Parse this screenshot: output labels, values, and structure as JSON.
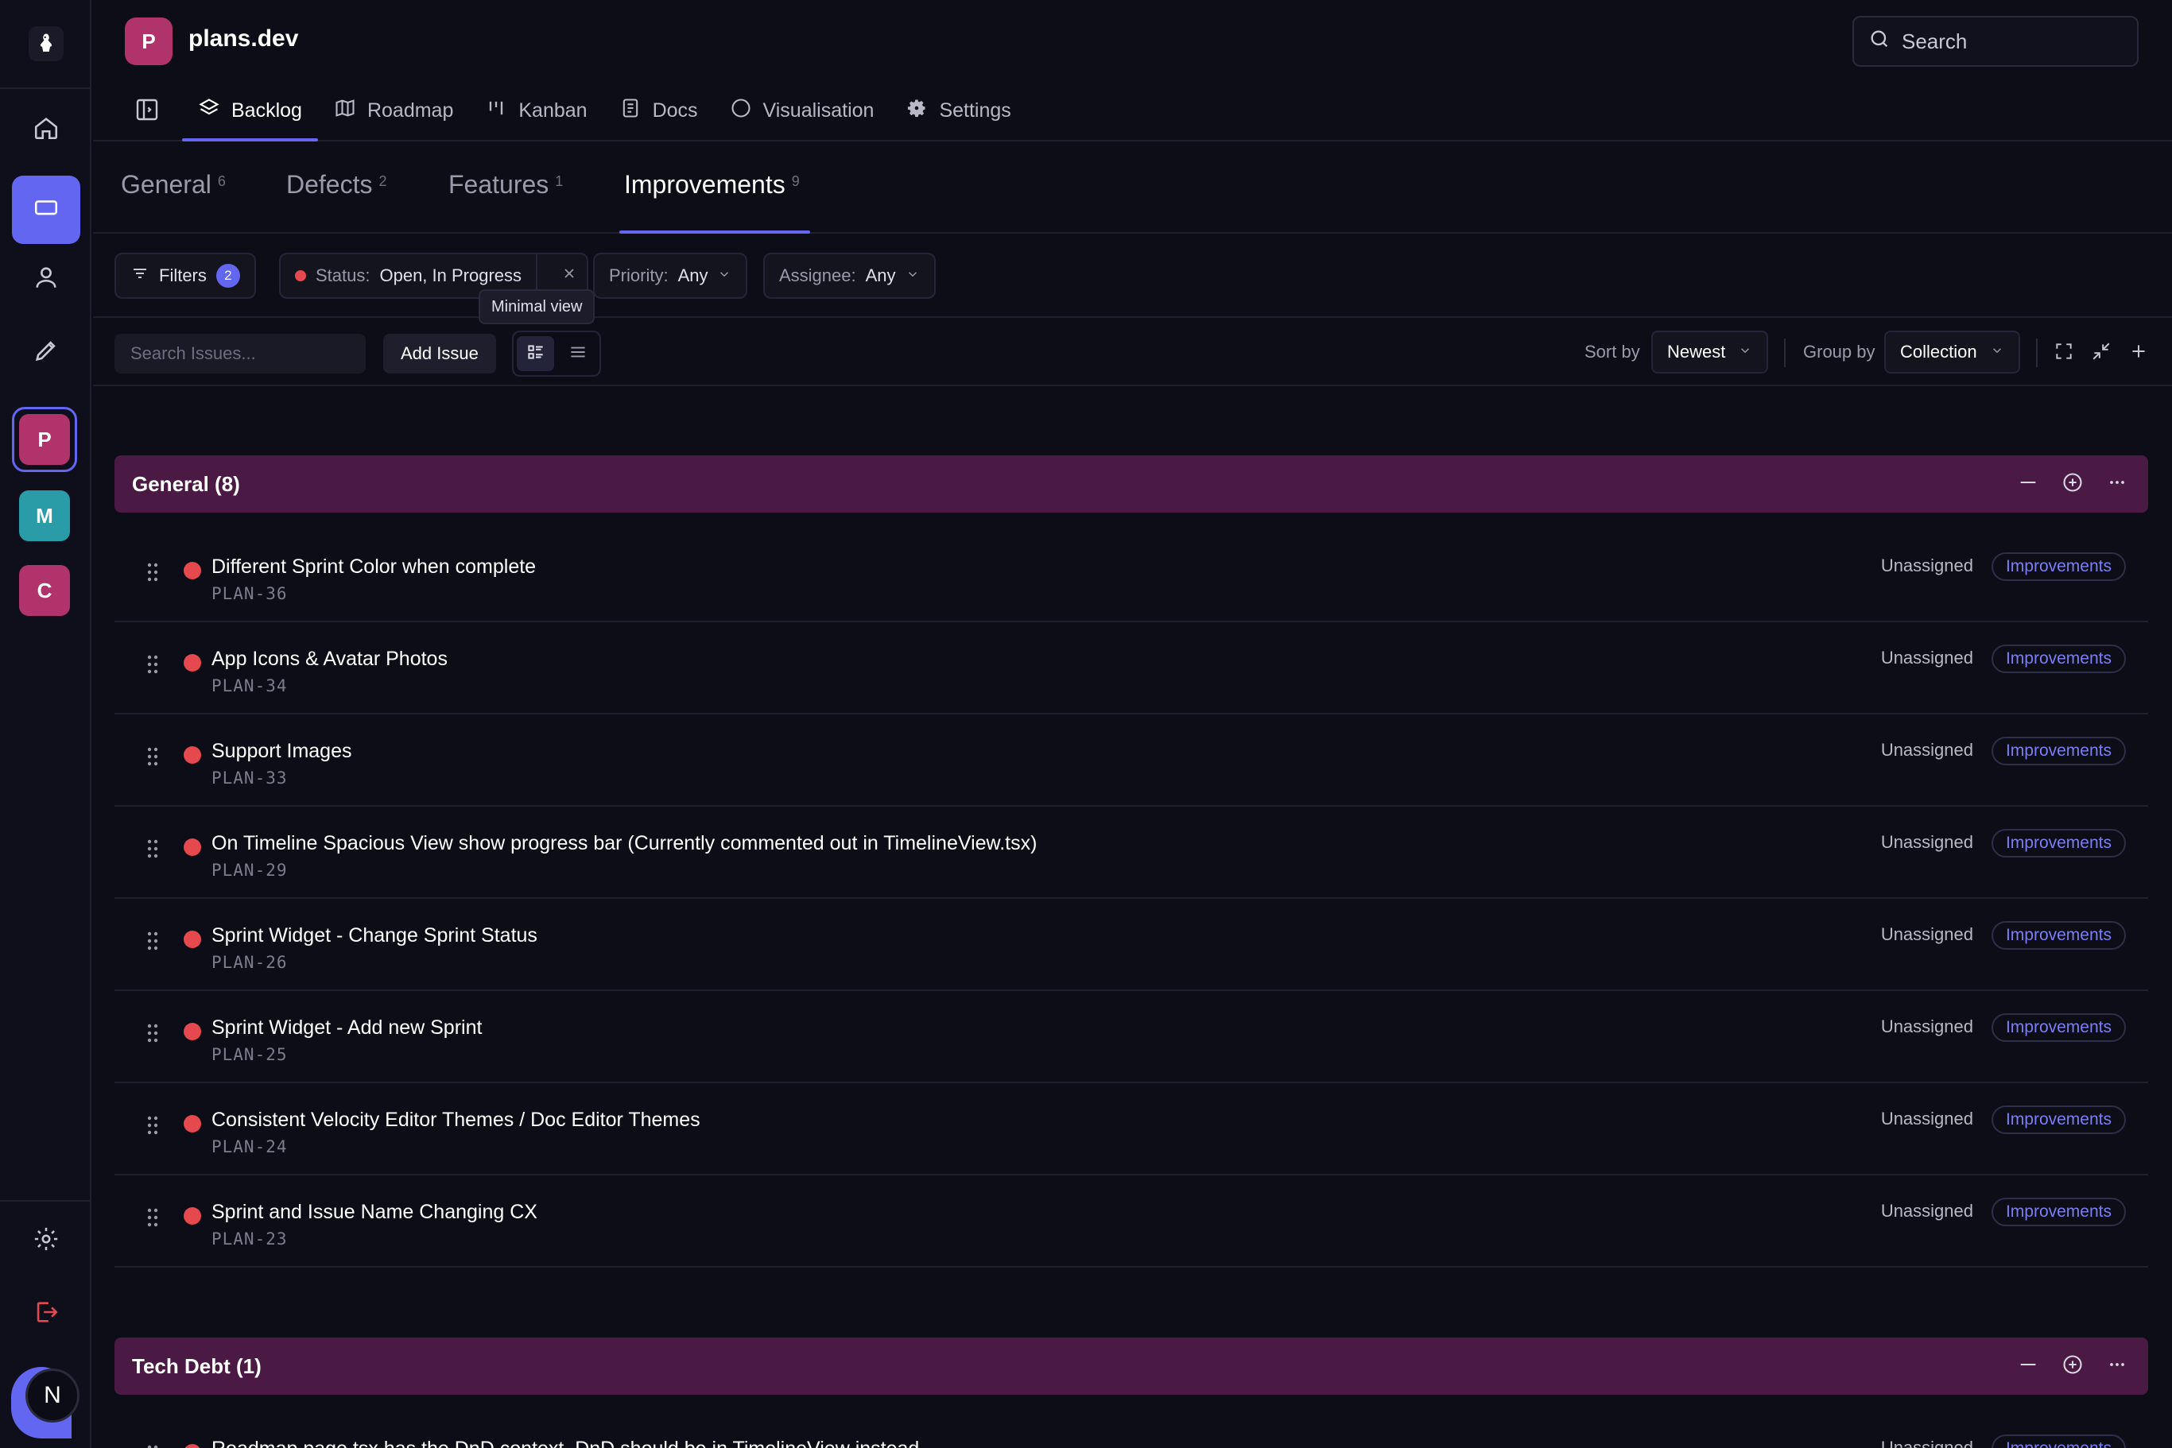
{
  "app": {
    "logo_icon": "mascot-icon",
    "project_initial": "P",
    "project_name": "plans.dev"
  },
  "sidebar": {
    "nav_icons": [
      "home-icon",
      "board-icon",
      "user-icon",
      "pencil-icon"
    ],
    "projects": [
      {
        "initial": "P",
        "color": "#b1336b",
        "active": true
      },
      {
        "initial": "M",
        "color": "#2a9ca8",
        "active": false
      },
      {
        "initial": "C",
        "color": "#b1336b",
        "active": false
      }
    ],
    "user_initial": "N",
    "accent": "#6366f1"
  },
  "search": {
    "placeholder": "Search"
  },
  "nav": {
    "tabs": [
      {
        "label": "Backlog",
        "icon": "layers-icon",
        "active": true
      },
      {
        "label": "Roadmap",
        "icon": "map-icon",
        "active": false
      },
      {
        "label": "Kanban",
        "icon": "kanban-icon",
        "active": false
      },
      {
        "label": "Docs",
        "icon": "doc-icon",
        "active": false
      },
      {
        "label": "Visualisation",
        "icon": "circle-icon",
        "active": false
      },
      {
        "label": "Settings",
        "icon": "gear-icon",
        "active": false
      }
    ]
  },
  "categories": [
    {
      "label": "General",
      "count": "6"
    },
    {
      "label": "Defects",
      "count": "2"
    },
    {
      "label": "Features",
      "count": "1"
    },
    {
      "label": "Improvements",
      "count": "9",
      "active": true
    }
  ],
  "filters": {
    "filters_label": "Filters",
    "filters_count": "2",
    "status_label": "Status:",
    "status_value": "Open, In Progress",
    "priority_label": "Priority:",
    "priority_value": "Any",
    "assignee_label": "Assignee:",
    "assignee_value": "Any",
    "tooltip": "Minimal view"
  },
  "toolbar": {
    "search_placeholder": "Search Issues...",
    "add_issue": "Add Issue",
    "sort_label": "Sort by",
    "sort_value": "Newest",
    "group_label": "Group by",
    "group_value": "Collection"
  },
  "groups": [
    {
      "title": "General (8)",
      "issues": [
        {
          "title": "Different Sprint Color when complete",
          "key": "PLAN-36",
          "assignee": "Unassigned",
          "tag": "Improvements"
        },
        {
          "title": "App Icons & Avatar Photos",
          "key": "PLAN-34",
          "assignee": "Unassigned",
          "tag": "Improvements"
        },
        {
          "title": "Support Images",
          "key": "PLAN-33",
          "assignee": "Unassigned",
          "tag": "Improvements"
        },
        {
          "title": "On Timeline Spacious View show progress bar (Currently commented out in TimelineView.tsx)",
          "key": "PLAN-29",
          "assignee": "Unassigned",
          "tag": "Improvements"
        },
        {
          "title": "Sprint Widget - Change Sprint Status",
          "key": "PLAN-26",
          "assignee": "Unassigned",
          "tag": "Improvements"
        },
        {
          "title": "Sprint Widget - Add new Sprint",
          "key": "PLAN-25",
          "assignee": "Unassigned",
          "tag": "Improvements"
        },
        {
          "title": "Consistent Velocity Editor Themes / Doc Editor Themes",
          "key": "PLAN-24",
          "assignee": "Unassigned",
          "tag": "Improvements"
        },
        {
          "title": "Sprint and Issue Name Changing CX",
          "key": "PLAN-23",
          "assignee": "Unassigned",
          "tag": "Improvements"
        }
      ]
    },
    {
      "title": "Tech Debt (1)",
      "issues": [
        {
          "title": "Roadmap page.tsx has the DnD context. DnD should be in TimelineView instead",
          "key": "",
          "assignee": "Unassigned",
          "tag": "Improvements"
        }
      ]
    }
  ],
  "colors": {
    "priority_urgent": "#e5484d",
    "group_header": "#4a1a45",
    "tag_text": "#7b7ff2"
  }
}
